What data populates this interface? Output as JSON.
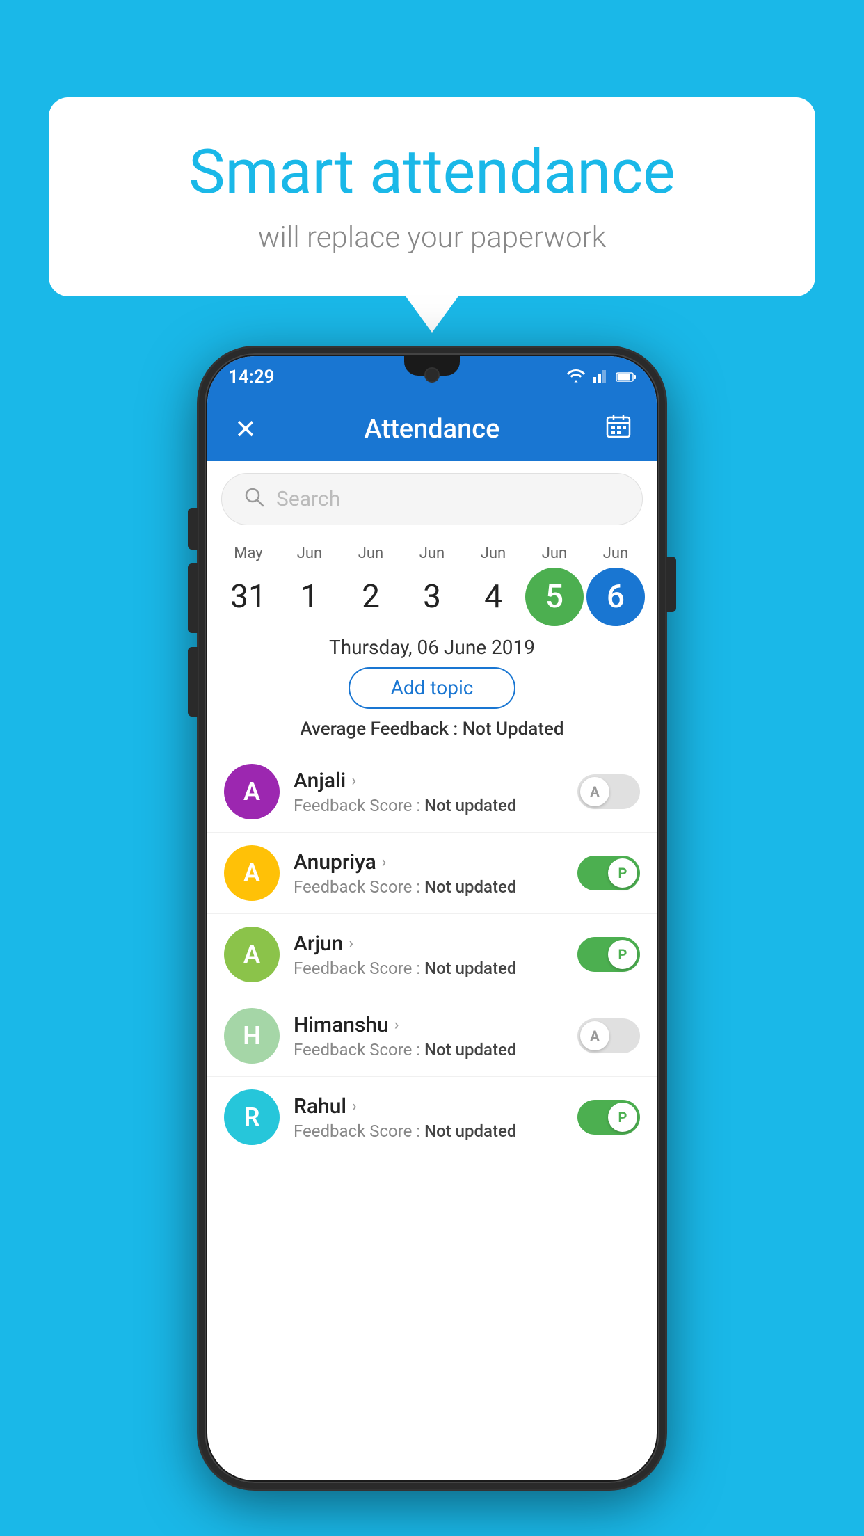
{
  "page": {
    "background_color": "#1ab8e8"
  },
  "speech_bubble": {
    "title": "Smart attendance",
    "subtitle": "will replace your paperwork"
  },
  "phone": {
    "status_bar": {
      "time": "14:29",
      "wifi": "▼",
      "signal": "▲",
      "battery": "▮"
    },
    "app_bar": {
      "close_label": "✕",
      "title": "Attendance",
      "calendar_icon": "📅"
    },
    "search": {
      "placeholder": "Search"
    },
    "calendar": {
      "dates": [
        {
          "month": "May",
          "day": "31",
          "style": "normal"
        },
        {
          "month": "Jun",
          "day": "1",
          "style": "normal"
        },
        {
          "month": "Jun",
          "day": "2",
          "style": "normal"
        },
        {
          "month": "Jun",
          "day": "3",
          "style": "normal"
        },
        {
          "month": "Jun",
          "day": "4",
          "style": "normal"
        },
        {
          "month": "Jun",
          "day": "5",
          "style": "today"
        },
        {
          "month": "Jun",
          "day": "6",
          "style": "selected"
        }
      ]
    },
    "selected_date": "Thursday, 06 June 2019",
    "add_topic_label": "Add topic",
    "avg_feedback_label": "Average Feedback :",
    "avg_feedback_value": "Not Updated",
    "students": [
      {
        "name": "Anjali",
        "avatar_letter": "A",
        "avatar_color": "#9c27b0",
        "feedback_label": "Feedback Score :",
        "feedback_value": "Not updated",
        "attendance": "absent"
      },
      {
        "name": "Anupriya",
        "avatar_letter": "A",
        "avatar_color": "#ffc107",
        "feedback_label": "Feedback Score :",
        "feedback_value": "Not updated",
        "attendance": "present"
      },
      {
        "name": "Arjun",
        "avatar_letter": "A",
        "avatar_color": "#8bc34a",
        "feedback_label": "Feedback Score :",
        "feedback_value": "Not updated",
        "attendance": "present"
      },
      {
        "name": "Himanshu",
        "avatar_letter": "H",
        "avatar_color": "#a5d6a7",
        "feedback_label": "Feedback Score :",
        "feedback_value": "Not updated",
        "attendance": "absent"
      },
      {
        "name": "Rahul",
        "avatar_letter": "R",
        "avatar_color": "#26c6da",
        "feedback_label": "Feedback Score :",
        "feedback_value": "Not updated",
        "attendance": "present"
      }
    ],
    "toggle_absent_letter": "A",
    "toggle_present_letter": "P"
  }
}
